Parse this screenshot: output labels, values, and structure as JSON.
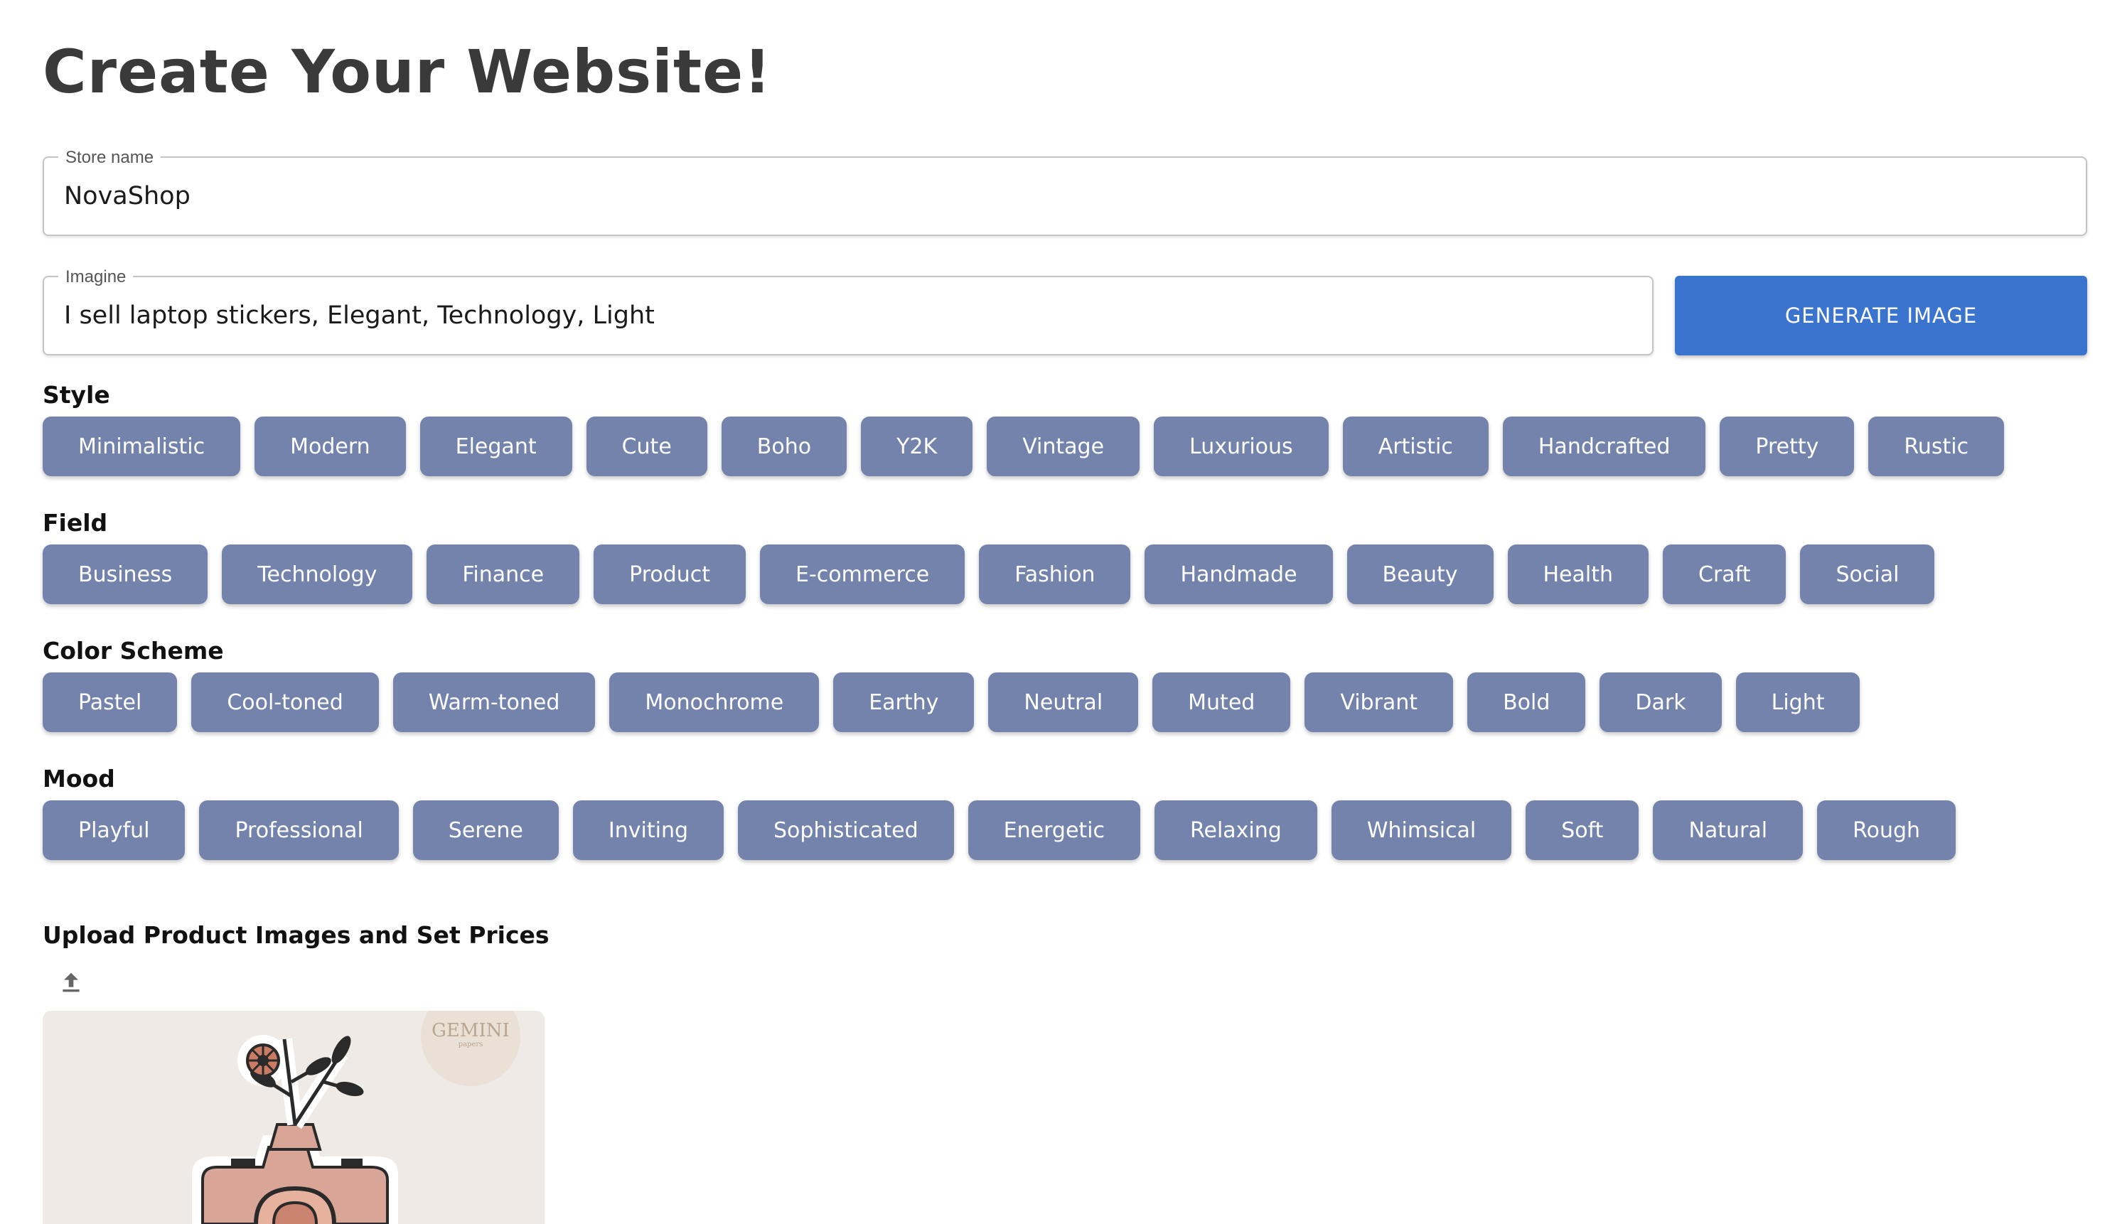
{
  "page": {
    "title": "Create Your Website!"
  },
  "store_name": {
    "label": "Store name",
    "value": "NovaShop"
  },
  "imagine": {
    "label": "Imagine",
    "value": "I sell laptop stickers, Elegant, Technology, Light"
  },
  "generate_button": {
    "label": "GENERATE IMAGE"
  },
  "colors": {
    "accent": "#3a74cf",
    "chip": "#7383ab",
    "title": "#3a3a3a"
  },
  "sections": [
    {
      "title": "Style",
      "chips": [
        "Minimalistic",
        "Modern",
        "Elegant",
        "Cute",
        "Boho",
        "Y2K",
        "Vintage",
        "Luxurious",
        "Artistic",
        "Handcrafted",
        "Pretty",
        "Rustic"
      ]
    },
    {
      "title": "Field",
      "chips": [
        "Business",
        "Technology",
        "Finance",
        "Product",
        "E-commerce",
        "Fashion",
        "Handmade",
        "Beauty",
        "Health",
        "Craft",
        "Social"
      ]
    },
    {
      "title": "Color Scheme",
      "chips": [
        "Pastel",
        "Cool-toned",
        "Warm-toned",
        "Monochrome",
        "Earthy",
        "Neutral",
        "Muted",
        "Vibrant",
        "Bold",
        "Dark",
        "Light"
      ]
    },
    {
      "title": "Mood",
      "chips": [
        "Playful",
        "Professional",
        "Serene",
        "Inviting",
        "Sophisticated",
        "Energetic",
        "Relaxing",
        "Whimsical",
        "Soft",
        "Natural",
        "Rough"
      ]
    }
  ],
  "upload": {
    "title": "Upload Product Images and Set Prices",
    "icon": "upload-icon"
  },
  "product_preview": {
    "watermark": "GEMINI",
    "watermark_sub": "papers"
  }
}
